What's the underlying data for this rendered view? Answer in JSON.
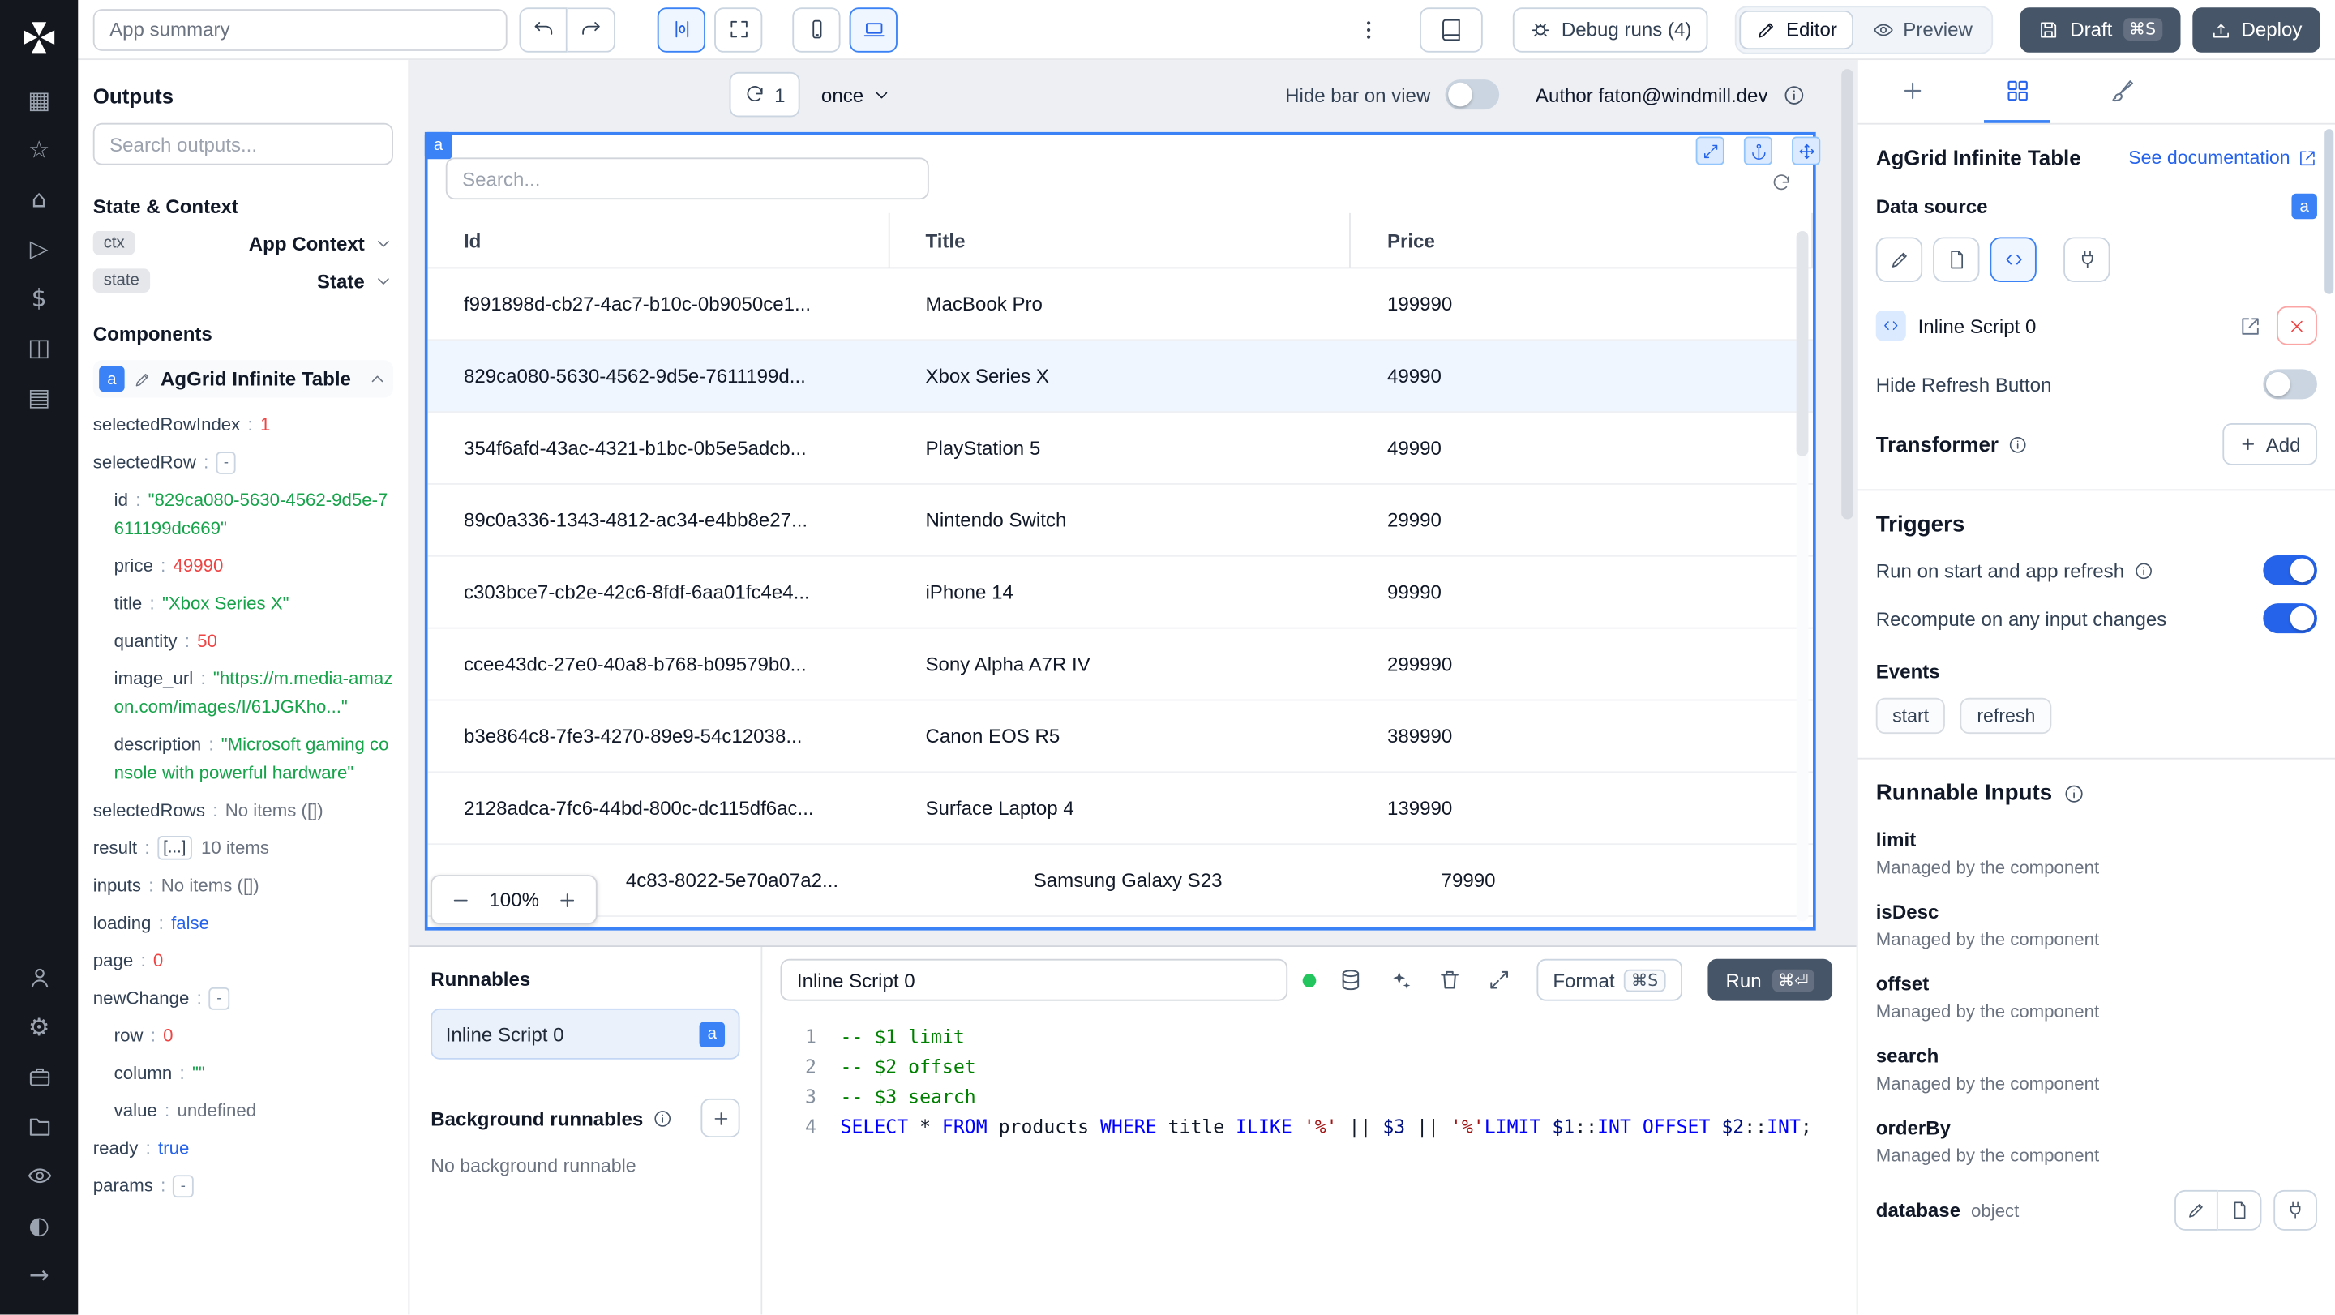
{
  "colors": {
    "accent": "#3b82f6",
    "dark_button": "#475569",
    "selected_row": "#eff6ff",
    "code_keyword": "#0000ff",
    "code_string": "#a31515",
    "code_comment": "#008000",
    "tree_number": "#ef4444",
    "tree_string": "#16a34a",
    "tree_bool": "#2563eb",
    "run_dot": "#22c55e",
    "danger": "#ef4444"
  },
  "topbar": {
    "app_summary_value": "App summary",
    "debug_runs_label": "Debug runs (4)",
    "editor_label": "Editor",
    "preview_label": "Preview",
    "draft_label": "Draft",
    "draft_kbd": "⌘S",
    "deploy_label": "Deploy"
  },
  "outputs_panel": {
    "title": "Outputs",
    "search_placeholder": "Search outputs...",
    "state_context_title": "State & Context",
    "ctx_badge": "ctx",
    "ctx_label": "App Context",
    "state_badge": "state",
    "state_label": "State",
    "components_title": "Components",
    "component_badge": "a",
    "component_name": "AgGrid Infinite Table",
    "tree": [
      {
        "indent": 0,
        "key": "selectedRowIndex",
        "value": "1",
        "vtype": "number"
      },
      {
        "indent": 0,
        "key": "selectedRow",
        "value": "-",
        "vtype": "box"
      },
      {
        "indent": 1,
        "key": "id",
        "value": "\"829ca080-5630-4562-9d5e-7611199dc669\"",
        "vtype": "string"
      },
      {
        "indent": 1,
        "key": "price",
        "value": "49990",
        "vtype": "number"
      },
      {
        "indent": 1,
        "key": "title",
        "value": "\"Xbox Series X\"",
        "vtype": "string"
      },
      {
        "indent": 1,
        "key": "quantity",
        "value": "50",
        "vtype": "number"
      },
      {
        "indent": 1,
        "key": "image_url",
        "value": "\"https://m.media-amazon.com/images/I/61JGKho...\"",
        "vtype": "string"
      },
      {
        "indent": 1,
        "key": "description",
        "value": "\"Microsoft gaming console with powerful hardware\"",
        "vtype": "string"
      },
      {
        "indent": 0,
        "key": "selectedRows",
        "value": "No items ([])",
        "vtype": "muted"
      },
      {
        "indent": 0,
        "key": "result",
        "value": "[...]",
        "vtype": "chip",
        "suffix": "10 items"
      },
      {
        "indent": 0,
        "key": "inputs",
        "value": "No items ([])",
        "vtype": "muted"
      },
      {
        "indent": 0,
        "key": "loading",
        "value": "false",
        "vtype": "bool"
      },
      {
        "indent": 0,
        "key": "page",
        "value": "0",
        "vtype": "number"
      },
      {
        "indent": 0,
        "key": "newChange",
        "value": "-",
        "vtype": "box"
      },
      {
        "indent": 1,
        "key": "row",
        "value": "0",
        "vtype": "number"
      },
      {
        "indent": 1,
        "key": "column",
        "value": "\"\"",
        "vtype": "string"
      },
      {
        "indent": 1,
        "key": "value",
        "value": "undefined",
        "vtype": "muted"
      },
      {
        "indent": 0,
        "key": "ready",
        "value": "true",
        "vtype": "bool"
      },
      {
        "indent": 0,
        "key": "params",
        "value": "-",
        "vtype": "box"
      }
    ]
  },
  "canvas": {
    "refresh_count": "1",
    "interval_value": "once",
    "hide_bar_label": "Hide bar on view",
    "author_label": "Author faton@windmill.dev",
    "component_badge": "a",
    "zoom_value": "100%"
  },
  "grid": {
    "search_placeholder": "Search...",
    "columns": [
      "Id",
      "Title",
      "Price"
    ],
    "rows": [
      {
        "id": "f991898d-cb27-4ac7-b10c-0b9050ce1...",
        "title": "MacBook Pro",
        "price": "199990",
        "selected": false,
        "offset": false
      },
      {
        "id": "829ca080-5630-4562-9d5e-7611199d...",
        "title": "Xbox Series X",
        "price": "49990",
        "selected": true,
        "offset": false
      },
      {
        "id": "354f6afd-43ac-4321-b1bc-0b5e5adcb...",
        "title": "PlayStation 5",
        "price": "49990",
        "selected": false,
        "offset": false
      },
      {
        "id": "89c0a336-1343-4812-ac34-e4bb8e27...",
        "title": "Nintendo Switch",
        "price": "29990",
        "selected": false,
        "offset": false
      },
      {
        "id": "c303bce7-cb2e-42c6-8fdf-6aa01fc4e4...",
        "title": "iPhone 14",
        "price": "99990",
        "selected": false,
        "offset": false
      },
      {
        "id": "ccee43dc-27e0-40a8-b768-b09579b0...",
        "title": "Sony Alpha A7R IV",
        "price": "299990",
        "selected": false,
        "offset": false
      },
      {
        "id": "b3e864c8-7fe3-4270-89e9-54c12038...",
        "title": "Canon EOS R5",
        "price": "389990",
        "selected": false,
        "offset": false
      },
      {
        "id": "2128adca-7fc6-44bd-800c-dc115df6ac...",
        "title": "Surface Laptop 4",
        "price": "139990",
        "selected": false,
        "offset": false
      },
      {
        "id": "4c83-8022-5e70a07a2...",
        "title": "Samsung Galaxy S23",
        "price": "79990",
        "selected": false,
        "offset": true
      }
    ]
  },
  "runnables": {
    "title": "Runnables",
    "items": [
      {
        "label": "Inline Script 0",
        "badge": "a",
        "selected": true
      }
    ],
    "background_title": "Background runnables",
    "background_empty": "No background runnable"
  },
  "script_editor": {
    "name_value": "Inline Script 0",
    "format_label": "Format",
    "format_kbd": "⌘S",
    "run_label": "Run",
    "run_kbd": "⌘⏎",
    "code": [
      {
        "tokens": [
          {
            "t": "cmt",
            "v": "-- $1 limit"
          }
        ]
      },
      {
        "tokens": [
          {
            "t": "cmt",
            "v": "-- $2 offset"
          }
        ]
      },
      {
        "tokens": [
          {
            "t": "cmt",
            "v": "-- $3 search"
          }
        ]
      },
      {
        "tokens": [
          {
            "t": "kw",
            "v": "SELECT"
          },
          {
            "t": "txt",
            "v": " * "
          },
          {
            "t": "kw",
            "v": "FROM"
          },
          {
            "t": "txt",
            "v": " products "
          },
          {
            "t": "kw",
            "v": "WHERE"
          },
          {
            "t": "txt",
            "v": " title "
          },
          {
            "t": "kw",
            "v": "ILIKE"
          },
          {
            "t": "txt",
            "v": " "
          },
          {
            "t": "str",
            "v": "'%'"
          },
          {
            "t": "txt",
            "v": " || "
          },
          {
            "t": "var",
            "v": "$3"
          },
          {
            "t": "txt",
            "v": " || "
          },
          {
            "t": "str",
            "v": "'%'"
          },
          {
            "t": "kw",
            "v": "LIMIT"
          },
          {
            "t": "txt",
            "v": " "
          },
          {
            "t": "var",
            "v": "$1"
          },
          {
            "t": "txt",
            "v": "::"
          },
          {
            "t": "kw",
            "v": "INT"
          },
          {
            "t": "txt",
            "v": " "
          },
          {
            "t": "kw",
            "v": "OFFSET"
          },
          {
            "t": "txt",
            "v": " "
          },
          {
            "t": "var",
            "v": "$2"
          },
          {
            "t": "txt",
            "v": "::"
          },
          {
            "t": "kw",
            "v": "INT"
          },
          {
            "t": "txt",
            "v": ";"
          }
        ]
      }
    ]
  },
  "settings": {
    "component_title": "AgGrid Infinite Table",
    "doc_link_label": "See documentation",
    "data_source_label": "Data source",
    "data_source_badge": "a",
    "script_name": "Inline Script 0",
    "hide_refresh_label": "Hide Refresh Button",
    "transformer_label": "Transformer",
    "add_label": "Add",
    "triggers_title": "Triggers",
    "run_on_start_label": "Run on start and app refresh",
    "recompute_label": "Recompute on any input changes",
    "events_label": "Events",
    "events": [
      "start",
      "refresh"
    ],
    "runnable_inputs_title": "Runnable Inputs",
    "inputs": [
      {
        "name": "limit",
        "desc": "Managed by the component"
      },
      {
        "name": "isDesc",
        "desc": "Managed by the component"
      },
      {
        "name": "offset",
        "desc": "Managed by the component"
      },
      {
        "name": "search",
        "desc": "Managed by the component"
      },
      {
        "name": "orderBy",
        "desc": "Managed by the component"
      }
    ],
    "database_label": "database",
    "database_type": "object"
  }
}
